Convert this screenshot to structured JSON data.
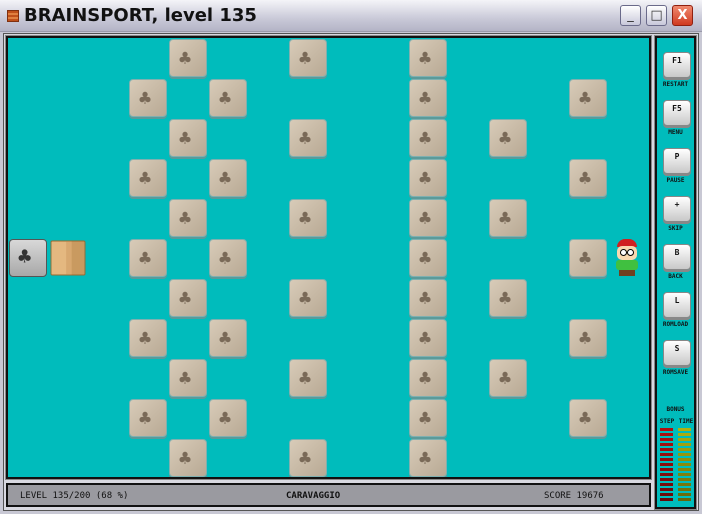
{
  "window": {
    "title": "BRAINSPORT, level 135",
    "minimize": "_",
    "maximize": "□",
    "close": "X"
  },
  "board": {
    "legend": {
      ".": "empty",
      "T": "clover-tile",
      "G": "gray-clover-tile",
      "B": "crate",
      "P": "player"
    },
    "rows": [
      "....T..T..T.....",
      "...T.T....T...T.",
      "....T..T..T.T...",
      "...T.T....T...T.",
      "....T..T..T.T...",
      "GB.T.T....T...TP",
      "....T..T..T.T...",
      "...T.T....T...T.",
      "....T..T..T.T...",
      "...T.T....T...T.",
      "....T..T..T....."
    ]
  },
  "sidebar": {
    "keys": [
      {
        "key": "F1",
        "label": "RESTART"
      },
      {
        "key": "F5",
        "label": "MENU"
      },
      {
        "key": "P",
        "label": "PAUSE"
      },
      {
        "key": "+",
        "label": "SKIP"
      },
      {
        "key": "B",
        "label": "BACK"
      },
      {
        "key": "L",
        "label": "ROMLOAD"
      },
      {
        "key": "S",
        "label": "ROMSAVE"
      }
    ],
    "bonus_label": "BONUS",
    "step_label": "STEP",
    "time_label": "TIME",
    "step_segments": 15,
    "time_segments": 15,
    "step_color": "#b01010",
    "time_color": "#b0b010"
  },
  "status": {
    "level": "LEVEL 135/200 (68 %)",
    "name": "CARAVAGGIO",
    "score": "SCORE 19676"
  }
}
